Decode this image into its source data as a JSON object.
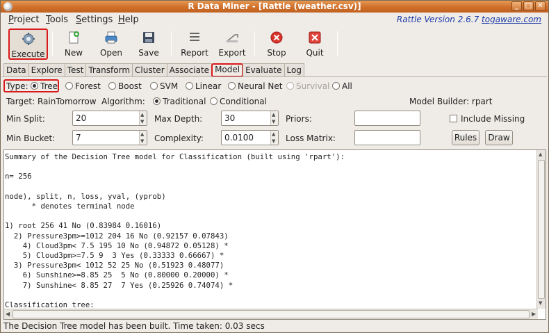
{
  "window": {
    "title": "R Data Miner - [Rattle (weather.csv)]",
    "controls": [
      "_",
      "□",
      "✕"
    ]
  },
  "menu": {
    "items": [
      {
        "u": "P",
        "rest": "roject"
      },
      {
        "u": "T",
        "rest": "ools"
      },
      {
        "u": "S",
        "rest": "ettings"
      },
      {
        "u": "H",
        "rest": "elp"
      }
    ]
  },
  "version": {
    "prefix": "Rattle Version 2.6.7 ",
    "link": "togaware.com"
  },
  "toolbar": {
    "execute": "Execute",
    "new": "New",
    "open": "Open",
    "save": "Save",
    "report": "Report",
    "export": "Export",
    "stop": "Stop",
    "quit": "Quit"
  },
  "tabs": [
    "Data",
    "Explore",
    "Test",
    "Transform",
    "Cluster",
    "Associate",
    "Model",
    "Evaluate",
    "Log"
  ],
  "active_tab": "Model",
  "model_type": {
    "label": "Type:",
    "options": [
      "Tree",
      "Forest",
      "Boost",
      "SVM",
      "Linear",
      "Neural Net",
      "Survival",
      "All"
    ],
    "selected": "Tree"
  },
  "target_row": {
    "target": "Target: RainTomorrow",
    "algorithm_label": "Algorithm:",
    "traditional": "Traditional",
    "conditional": "Conditional",
    "model_builder": "Model Builder:  rpart"
  },
  "params": {
    "min_split_label": "Min Split:",
    "min_split": "20",
    "max_depth_label": "Max Depth:",
    "max_depth": "30",
    "priors_label": "Priors:",
    "include_missing": "Include Missing",
    "min_bucket_label": "Min Bucket:",
    "min_bucket": "7",
    "complexity_label": "Complexity:",
    "complexity": "0.0100",
    "loss_matrix_label": "Loss Matrix:",
    "rules_btn": "Rules",
    "draw_btn": "Draw"
  },
  "output_lines": [
    "Summary of the Decision Tree model for Classification (built using 'rpart'):",
    "",
    "n= 256",
    "",
    "node), split, n, loss, yval, (yprob)",
    "      * denotes terminal node",
    "",
    "1) root 256 41 No (0.83984 0.16016)",
    "  2) Pressure3pm>=1012 204 16 No (0.92157 0.07843)",
    "    4) Cloud3pm< 7.5 195 10 No (0.94872 0.05128) *",
    "    5) Cloud3pm>=7.5 9  3 Yes (0.33333 0.66667) *",
    "  3) Pressure3pm< 1012 52 25 No (0.51923 0.48077)",
    "    6) Sunshine>=8.85 25  5 No (0.80000 0.20000) *",
    "    7) Sunshine< 8.85 27  7 Yes (0.25926 0.74074) *",
    "",
    "Classification tree:"
  ],
  "status": "The Decision Tree model has been built. Time taken: 0.03 secs",
  "colors": {
    "titlebar": "#cf6f2a",
    "highlight": "#d81a1a",
    "link": "#1a3aa8"
  }
}
